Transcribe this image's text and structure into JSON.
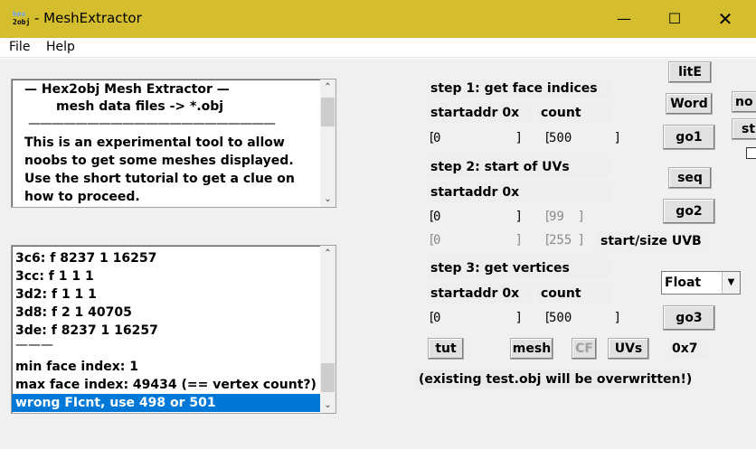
{
  "window": {
    "icon_top": "hex",
    "icon_bottom": "2obj",
    "title": "- MeshExtractor",
    "minimize_glyph": "—",
    "maximize_glyph": "☐",
    "close_glyph": "✕"
  },
  "menu": {
    "file": "File",
    "help": "Help"
  },
  "info": {
    "heading": "—   Hex2obj Mesh Extractor   —",
    "subheading": "mesh data files -> *.obj",
    "rule": "—————————————————————",
    "lines": [
      "This is an experimental tool to allow",
      "noobs to get some meshes displayed.",
      "Use the short tutorial to get a clue on",
      "how to proceed."
    ]
  },
  "log": {
    "rows": [
      "3c6: f  8237 1 16257",
      "3cc: f  1 1 1",
      "3d2: f  1 1 1",
      "3d8: f  2 1 40705",
      "3de: f  8237 1 16257",
      "———",
      "min face index: 1",
      "max face index: 49434 (== vertex count?)"
    ],
    "selected": "wrong FIcnt, use 498 or 501"
  },
  "step1": {
    "title": "step 1: get face indices",
    "startaddr_label": "startaddr 0x",
    "count_label": "count",
    "startaddr": "0",
    "count": "500",
    "go": "go1"
  },
  "step2": {
    "title": "step 2: start of UVs",
    "startaddr_label": "startaddr 0x",
    "startaddr": "0",
    "stride": "99",
    "uvb_start": "0",
    "uvb_size": "255",
    "uvb_label": "start/size UVB",
    "go": "go2"
  },
  "step3": {
    "title": "step 3: get vertices",
    "startaddr_label": "startaddr 0x",
    "count_label": "count",
    "startaddr": "0",
    "count": "500",
    "format": "Float",
    "go": "go3"
  },
  "buttons": {
    "lite": "litE",
    "word": "Word",
    "seq": "seq",
    "tut": "tut",
    "mesh": "mesh",
    "cf": "CF",
    "uvs": "UVs",
    "no": "no",
    "st": "st"
  },
  "hex_value": "0x7",
  "warning": "(existing test.obj will be overwritten!)"
}
